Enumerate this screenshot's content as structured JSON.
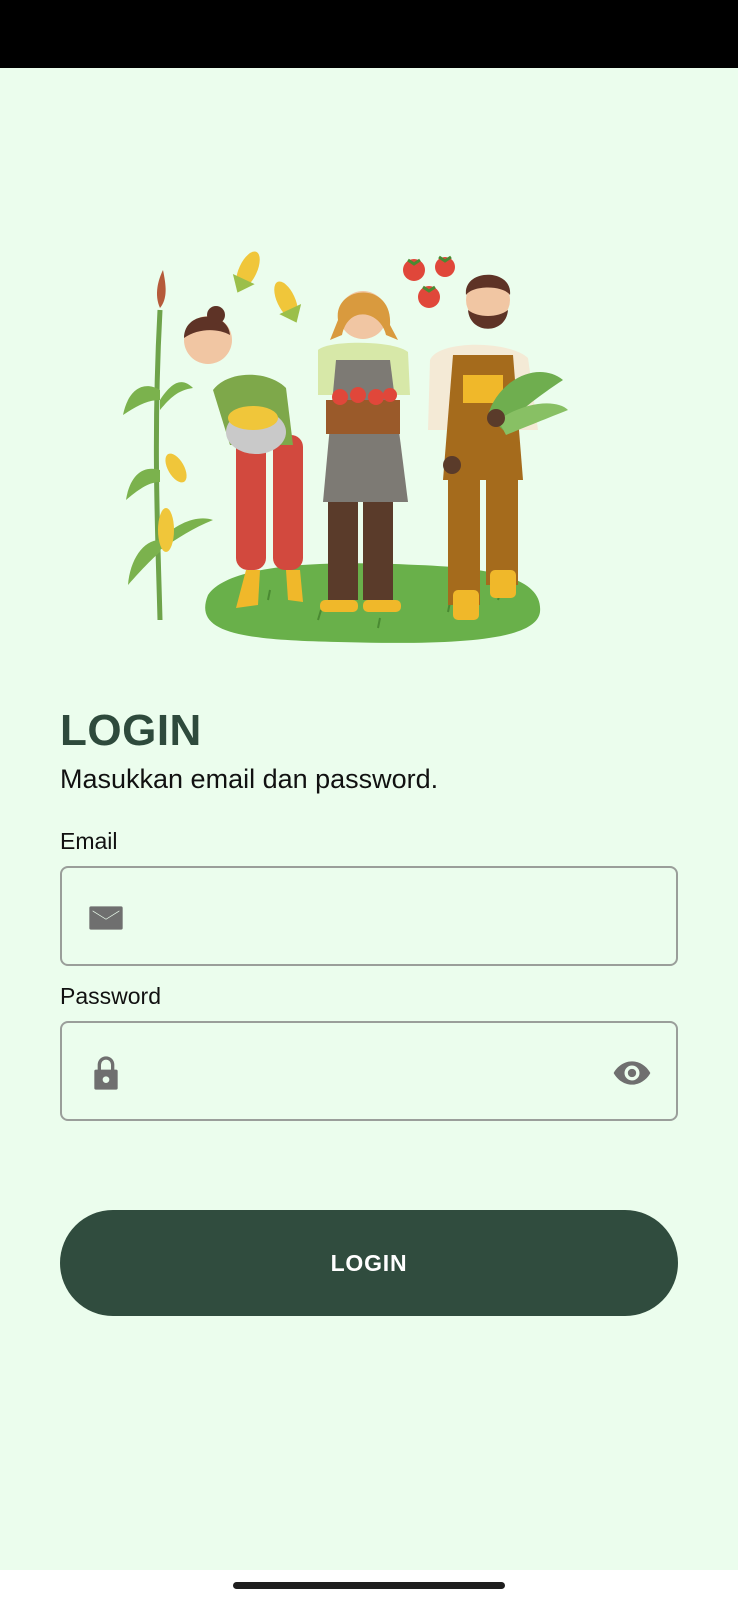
{
  "header": {
    "title": "LOGIN",
    "subtitle": "Masukkan email dan password."
  },
  "email": {
    "label": "Email",
    "value": "",
    "placeholder": "",
    "icon": "email-icon"
  },
  "password": {
    "label": "Password",
    "value": "",
    "placeholder": "",
    "icon": "lock-icon",
    "toggle_icon": "eye-icon"
  },
  "actions": {
    "login_label": "LOGIN"
  },
  "colors": {
    "background": "#ebfded",
    "primary": "#304c3e",
    "title": "#2e4a3c",
    "icon": "#6f6f6f"
  }
}
